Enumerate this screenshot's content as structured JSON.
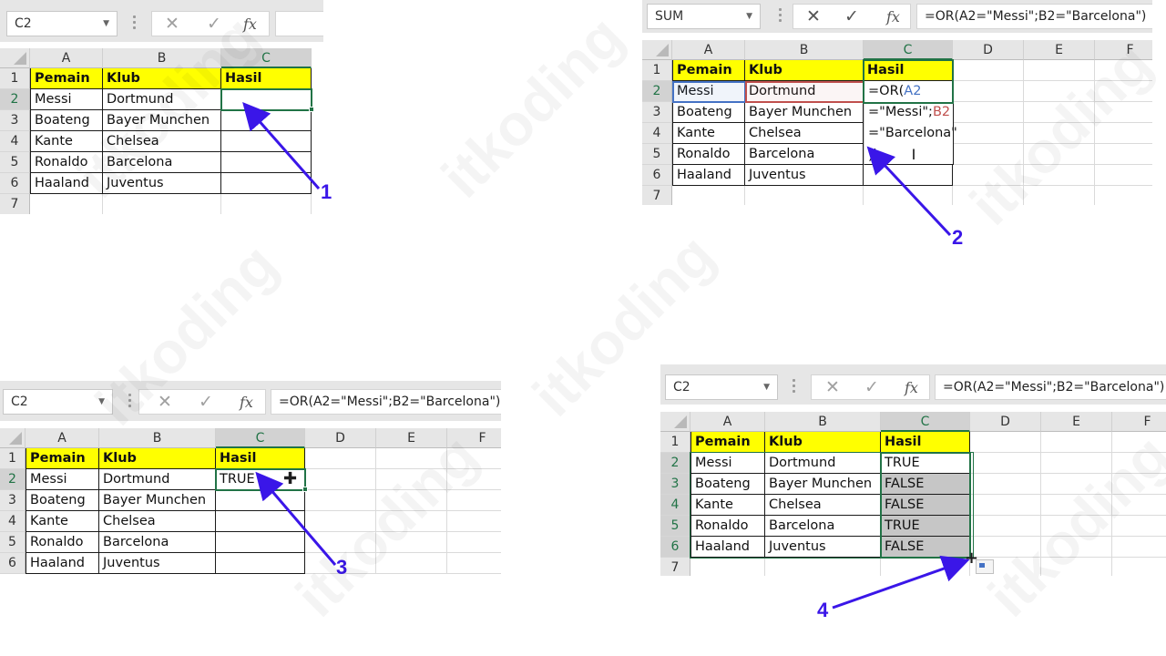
{
  "watermark": "itkoding",
  "colors": {
    "header_fill": "#ffff00",
    "selection": "#217346",
    "arrow": "#3a16e8",
    "ref_a": "#4472c4",
    "ref_b": "#c0504d",
    "filled_range": "#c6c6c6"
  },
  "columns": [
    "A",
    "B",
    "C",
    "D",
    "E",
    "F"
  ],
  "rows": [
    "1",
    "2",
    "3",
    "4",
    "5",
    "6",
    "7"
  ],
  "table": {
    "headers": [
      "Pemain",
      "Klub",
      "Hasil"
    ],
    "players": [
      "Messi",
      "Boateng",
      "Kante",
      "Ronaldo",
      "Haaland"
    ],
    "clubs": [
      "Dortmund",
      "Bayer Munchen",
      "Chelsea",
      "Barcelona",
      "Juventus"
    ]
  },
  "panels": [
    {
      "step": "1",
      "name_box": "C2",
      "formula": "",
      "results": [
        "",
        "",
        "",
        "",
        ""
      ]
    },
    {
      "step": "2",
      "name_box": "SUM",
      "formula": "=OR(A2=\"Messi\";B2=\"Barcelona\")",
      "edit_lines": {
        "l1_prefix": "=OR(",
        "l1_ref": "A2",
        "l2_prefix": "=\"Messi\";",
        "l2_ref": "B2",
        "l3": "=\"Barcelona\"",
        "l4": ")"
      }
    },
    {
      "step": "3",
      "name_box": "C2",
      "formula": "=OR(A2=\"Messi\";B2=\"Barcelona\")",
      "results": [
        "TRUE",
        "",
        "",
        "",
        ""
      ]
    },
    {
      "step": "4",
      "name_box": "C2",
      "formula": "=OR(A2=\"Messi\";B2=\"Barcelona\")",
      "results": [
        "TRUE",
        "FALSE",
        "FALSE",
        "TRUE",
        "FALSE"
      ]
    }
  ],
  "icons": {
    "cancel": "✕",
    "enter": "✓",
    "fx": "fx",
    "dropdown": "▼"
  }
}
